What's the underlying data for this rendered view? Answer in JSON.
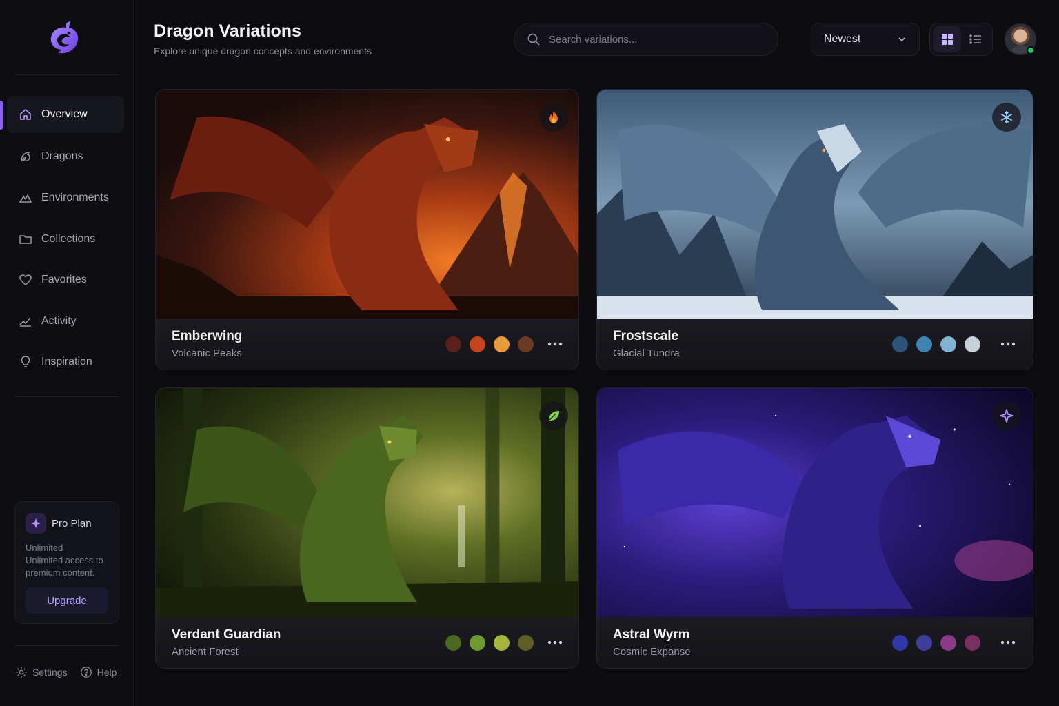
{
  "header": {
    "title": "Dragon Variations",
    "subtitle": "Explore unique dragon concepts and environments",
    "search_placeholder": "Search variations...",
    "sort_label": "Newest"
  },
  "sidebar": {
    "items": [
      {
        "label": "Overview",
        "icon": "home-icon",
        "active": true
      },
      {
        "label": "Dragons",
        "icon": "dragon-icon"
      },
      {
        "label": "Environments",
        "icon": "mountain-icon"
      },
      {
        "label": "Collections",
        "icon": "folder-icon"
      },
      {
        "label": "Favorites",
        "icon": "heart-icon"
      },
      {
        "label": "Activity",
        "icon": "activity-icon"
      },
      {
        "label": "Inspiration",
        "icon": "lightbulb-icon"
      }
    ],
    "pro": {
      "title": "Pro Plan",
      "line1": "Unlimited",
      "line2": "Unlimited access to premium content.",
      "button": "Upgrade"
    },
    "footer": {
      "settings": "Settings",
      "help": "Help"
    }
  },
  "cards": [
    {
      "name": "Emberwing",
      "location": "Volcanic Peaks",
      "icon": "flame-icon",
      "swatches": [
        "#5c1f1a",
        "#c2451f",
        "#e79a3a",
        "#6b3a22"
      ]
    },
    {
      "name": "Frostscale",
      "location": "Glacial Tundra",
      "icon": "snowflake-icon",
      "swatches": [
        "#2c5478",
        "#3d83ad",
        "#7fb4d3",
        "#c7d1da"
      ]
    },
    {
      "name": "Verdant Guardian",
      "location": "Ancient Forest",
      "icon": "leaf-icon",
      "swatches": [
        "#4a6a22",
        "#6e9b2f",
        "#a7b53c",
        "#5f5e27"
      ]
    },
    {
      "name": "Astral Wyrm",
      "location": "Cosmic Expanse",
      "icon": "sparkle-icon",
      "swatches": [
        "#3038a8",
        "#3c3f9a",
        "#8a3a86",
        "#7a2f63"
      ]
    }
  ],
  "colors": {
    "accent": "#8b5cf6",
    "online": "#22c55e"
  }
}
